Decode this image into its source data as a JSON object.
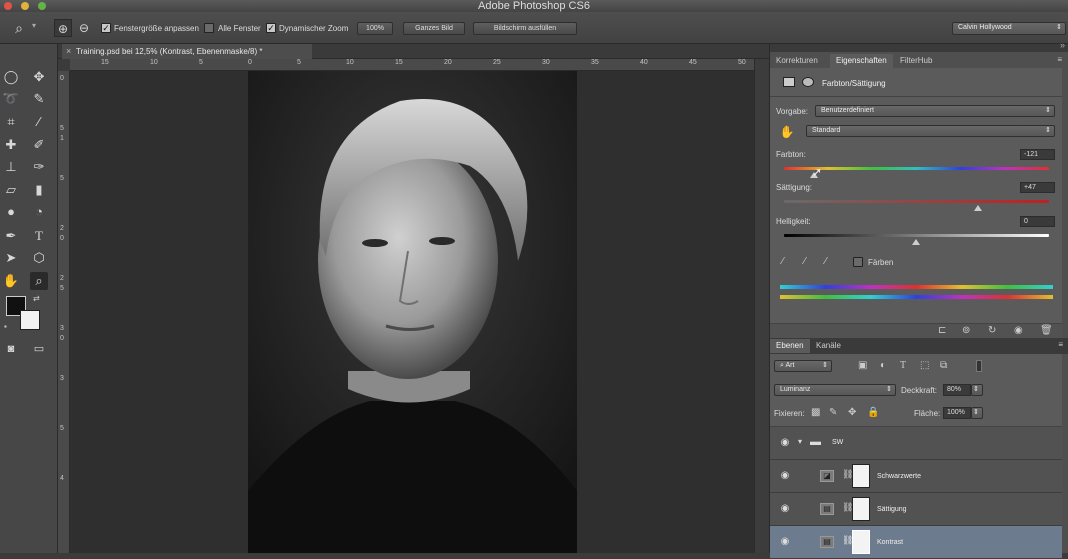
{
  "window": {
    "title": "Adobe Photoshop CS6"
  },
  "options": {
    "resize_windows_label": "Fenstergröße anpassen",
    "all_windows_label": "Alle Fenster",
    "scrubby_zoom_label": "Dynamischer Zoom",
    "zoom_value": "100%",
    "fit_screen_label": "Ganzes Bild",
    "fill_screen_label": "Bildschirm ausfüllen",
    "workspace": "Calvin Hollywood"
  },
  "document": {
    "tab_title": "Training.psd bei 12,5% (Kontrast, Ebenenmaske/8) *",
    "ruler_h": [
      "15",
      "10",
      "5",
      "0",
      "5",
      "10",
      "15",
      "20",
      "25",
      "30",
      "35",
      "40",
      "45",
      "50"
    ],
    "ruler_v": [
      "0",
      "5",
      "1",
      "5",
      "2",
      "0",
      "2",
      "5",
      "3",
      "0",
      "3",
      "5",
      "4"
    ]
  },
  "properties": {
    "tabs": [
      "Korrekturen",
      "Eigenschaften",
      "FilterHub"
    ],
    "active_tab": "Eigenschaften",
    "panel_title": "Farbton/Sättigung",
    "preset_label": "Vorgabe:",
    "preset_value": "Benutzerdefiniert",
    "channel_value": "Standard",
    "hue_label": "Farbton:",
    "hue_value": "-121",
    "saturation_label": "Sättigung:",
    "saturation_value": "+47",
    "lightness_label": "Helligkeit:",
    "lightness_value": "0",
    "colorize_label": "Färben"
  },
  "layers": {
    "tabs": [
      "Ebenen",
      "Kanäle"
    ],
    "filter_kind": "Art",
    "blend_mode": "Luminanz",
    "opacity_label": "Deckkraft:",
    "opacity_value": "80%",
    "lock_label": "Fixieren:",
    "fill_label": "Fläche:",
    "fill_value": "100%",
    "items": [
      {
        "name": "SW",
        "type": "group"
      },
      {
        "name": "Schwarzwerte",
        "type": "adjustment"
      },
      {
        "name": "Sättigung",
        "type": "adjustment"
      },
      {
        "name": "Kontrast",
        "type": "adjustment",
        "selected": true
      }
    ]
  },
  "colors": {
    "foreground": "#111111",
    "background": "#f2f2f2",
    "selection": "#6c7b8e"
  }
}
